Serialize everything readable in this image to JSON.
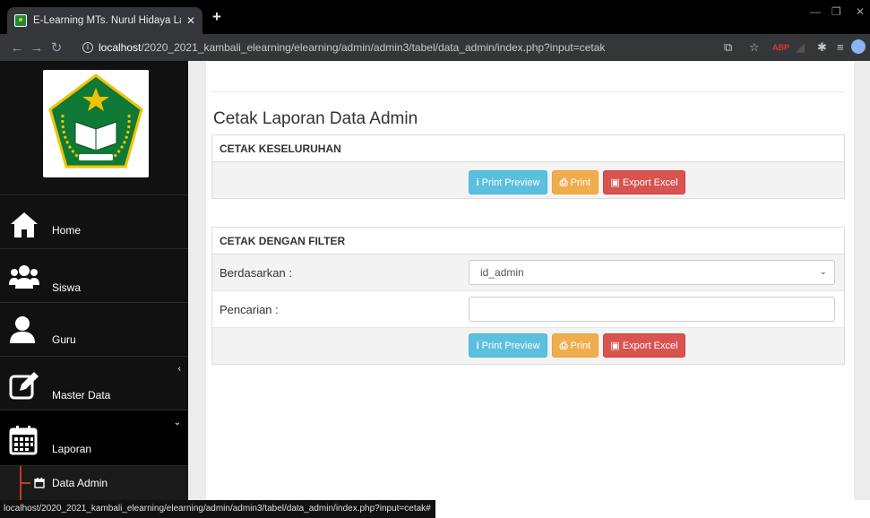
{
  "browser": {
    "tab_title": "E-Learning MTs. Nurul Hidaya La",
    "tab_close": "✕",
    "new_tab": "+",
    "url_host": "localhost",
    "url_path": "/2020_2021_kambali_elearning/elearning/admin/admin3/tabel/data_admin/index.php?input=cetak",
    "status_url": "localhost/2020_2021_kambali_elearning/elearning/admin/admin3/tabel/data_admin/index.php?input=cetak#"
  },
  "sidebar": {
    "items": [
      {
        "label": "Home",
        "icon": "home-icon"
      },
      {
        "label": "Siswa",
        "icon": "users-icon"
      },
      {
        "label": "Guru",
        "icon": "user-icon"
      },
      {
        "label": "Master Data",
        "icon": "edit-icon",
        "caret": "‹"
      },
      {
        "label": "Laporan",
        "icon": "calendar-icon",
        "caret": "⌄"
      }
    ],
    "submenu": {
      "label": "Data Admin",
      "icon": "calendar-small-icon"
    }
  },
  "main": {
    "title": "Cetak Laporan Data Admin",
    "panel1": {
      "heading": "CETAK KESELURUHAN",
      "btn_preview": "Print Preview",
      "btn_print": "Print",
      "btn_excel": "Export Excel"
    },
    "panel2": {
      "heading": "CETAK DENGAN FILTER",
      "label_based": "Berdasarkan :",
      "select_value": "id_admin",
      "label_search": "Pencarian :",
      "search_value": "",
      "btn_preview": "Print Preview",
      "btn_print": "Print",
      "btn_excel": "Export Excel"
    }
  },
  "colors": {
    "info": "#5bc0de",
    "warning": "#f0ad4e",
    "danger": "#d9534f",
    "sidebar": "#111111"
  }
}
